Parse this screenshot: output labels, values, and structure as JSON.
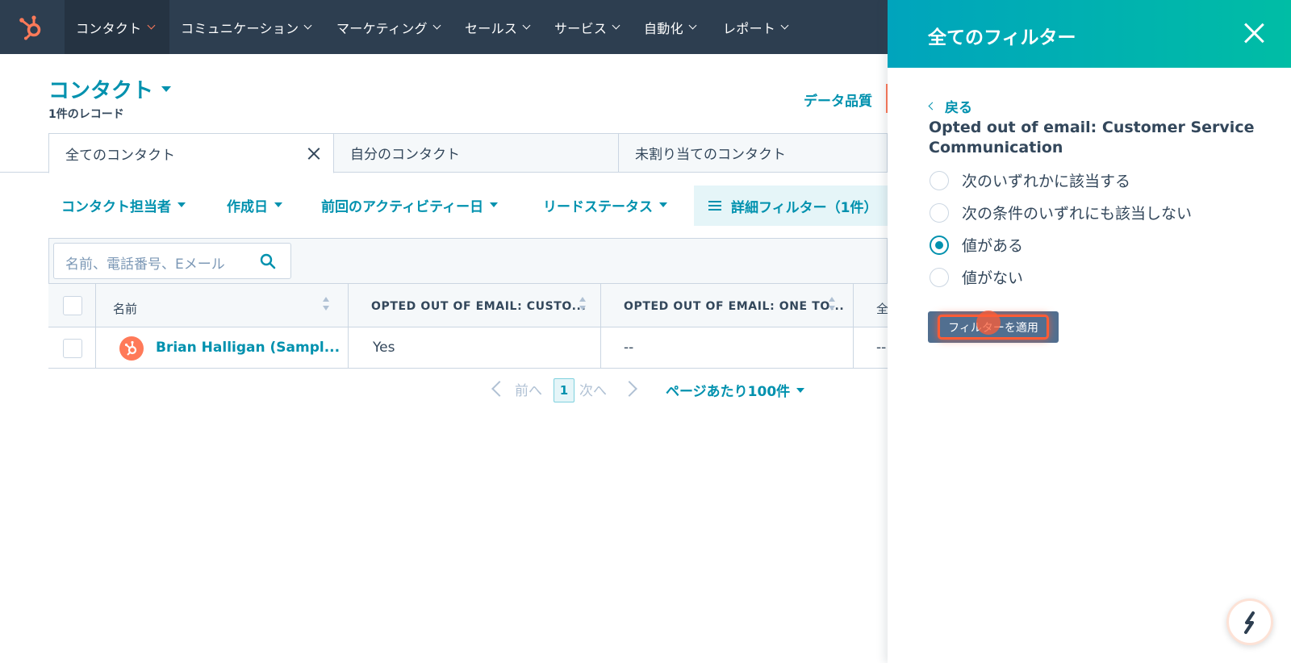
{
  "nav": {
    "items": [
      {
        "label": "コンタクト"
      },
      {
        "label": "コミュニケーション"
      },
      {
        "label": "マーケティング"
      },
      {
        "label": "セールス"
      },
      {
        "label": "サービス"
      },
      {
        "label": "自動化"
      },
      {
        "label": "レポート"
      }
    ]
  },
  "page": {
    "title": "コンタクト",
    "record_count": "1件のレコード",
    "data_quality": "データ品質"
  },
  "tabs": [
    {
      "label": "全てのコンタクト"
    },
    {
      "label": "自分のコンタクト"
    },
    {
      "label": "未割り当てのコンタクト"
    }
  ],
  "filters": {
    "owner": "コンタクト担当者",
    "created": "作成日",
    "last_activity": "前回のアクティビティー日",
    "lead_status": "リードステータス",
    "advanced": "詳細フィルター（1件）"
  },
  "search": {
    "placeholder": "名前、電話番号、Eメール"
  },
  "table": {
    "columns": [
      "名前",
      "OPTED OUT OF EMAIL: CUSTO...",
      "OPTED OUT OF EMAIL: ONE TO...",
      "全"
    ],
    "rows": [
      {
        "name": "Brian Halligan (Sampl...",
        "opted_customer": "Yes",
        "opted_one": "--",
        "all": "--"
      }
    ]
  },
  "pagination": {
    "prev": "前へ",
    "current": "1",
    "next": "次へ",
    "per_page": "ページあたり100件"
  },
  "panel": {
    "title": "全てのフィルター",
    "back": "戻る",
    "property": "Opted out of email: Customer Service Communication",
    "options": [
      {
        "label": "次のいずれかに該当する",
        "selected": false
      },
      {
        "label": "次の条件のいずれにも該当しない",
        "selected": false
      },
      {
        "label": "値がある",
        "selected": true
      },
      {
        "label": "値がない",
        "selected": false
      }
    ],
    "apply": "フィルターを適用"
  },
  "colors": {
    "nav_bg": "#2d3e50",
    "accent": "#0091ae",
    "brand_orange": "#ff7a59",
    "panel_gradient_start": "#00a4bd",
    "panel_gradient_end": "#00bda5"
  }
}
